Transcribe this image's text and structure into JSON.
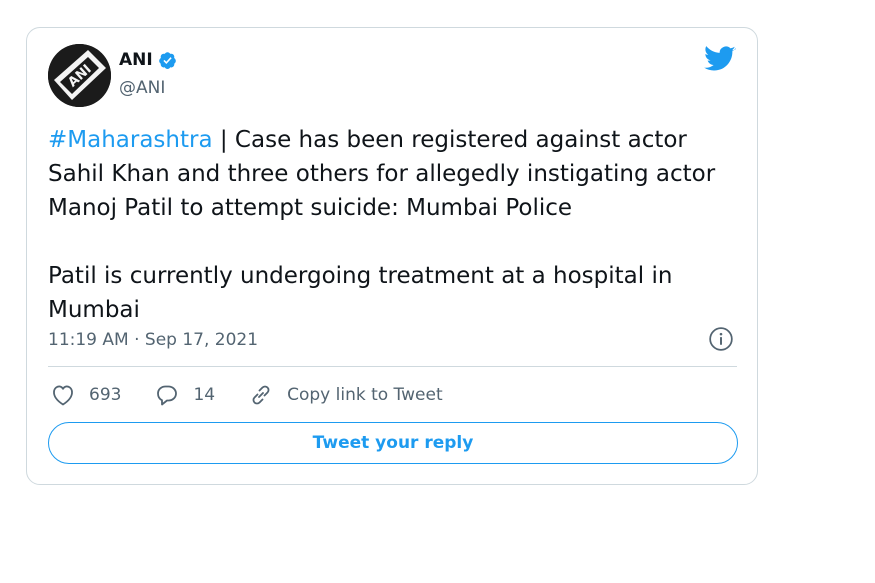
{
  "author": {
    "name": "ANI",
    "handle": "@ANI",
    "avatar_text": "ANI",
    "verified": true
  },
  "tweet": {
    "hashtag": "#Maharashtra",
    "text_after_hashtag": " | Case has been registered against actor Sahil Khan and three others for allegedly instigating actor Manoj Patil to attempt suicide: Mumbai Police\n\nPatil is currently undergoing treatment at a hospital in Mumbai",
    "timestamp": "11:19 AM · Sep 17, 2021"
  },
  "actions": {
    "likes": "693",
    "replies": "14",
    "copy_link_label": "Copy link to Tweet"
  },
  "reply_button_label": "Tweet your reply",
  "icons": {
    "bird": "twitter-bird-icon",
    "verified": "verified-badge-icon",
    "info": "info-icon",
    "heart": "heart-icon",
    "reply": "reply-bubble-icon",
    "link": "link-icon"
  },
  "colors": {
    "accent": "#1d9bf0",
    "text": "#0f1419",
    "secondary": "#536471",
    "border": "#cfd9de"
  }
}
